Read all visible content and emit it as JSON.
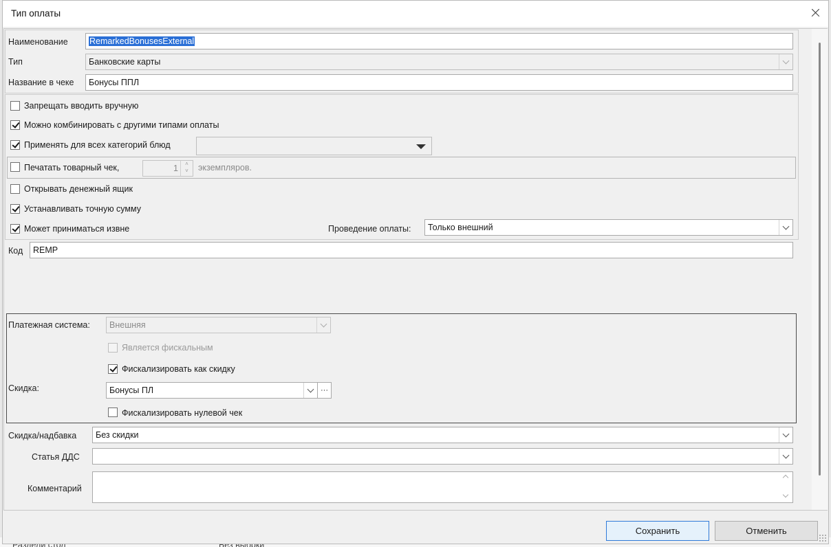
{
  "dialog": {
    "title": "Тип оплаты"
  },
  "fields": {
    "name_label": "Наименование",
    "name_value": "RemarkedBonusesExternal",
    "type_label": "Тип",
    "type_value": "Банковские карты",
    "receipt_name_label": "Название в чеке",
    "receipt_name_value": "Бонусы ППЛ",
    "code_label": "Код",
    "code_value": "REMP"
  },
  "options": {
    "forbid_manual": {
      "label": "Запрещать вводить вручную",
      "checked": false
    },
    "combine": {
      "label": "Можно комбинировать с другими типами оплаты",
      "checked": true
    },
    "all_categories": {
      "label": "Применять для всех категорий блюд",
      "checked": true,
      "dropdown_value": ""
    },
    "print_receipt": {
      "label": "Печатать товарный чек,",
      "checked": false,
      "copies": "1",
      "copies_suffix": "экземпляров."
    },
    "open_drawer": {
      "label": "Открывать денежный ящик",
      "checked": false
    },
    "exact_sum": {
      "label": "Устанавливать точную сумму",
      "checked": true
    },
    "external": {
      "label": "Может приниматься извне",
      "checked": true
    },
    "processing_label": "Проведение оплаты:",
    "processing_value": "Только внешний"
  },
  "payment_system": {
    "label": "Платежная система:",
    "value": "Внешняя",
    "is_fiscal": {
      "label": "Является фискальным",
      "checked": false,
      "disabled": true
    },
    "fiscalize_discount": {
      "label": "Фискализировать как скидку",
      "checked": true
    },
    "discount_label": "Скидка:",
    "discount_value": "Бонусы ПЛ",
    "ellipsis": "···",
    "fiscalize_zero": {
      "label": "Фискализировать нулевой чек",
      "checked": false
    }
  },
  "bottom": {
    "surcharge_label": "Скидка/надбавка",
    "surcharge_value": "Без скидки",
    "dds_label": "Статья ДДС",
    "dds_value": "",
    "comment_label": "Комментарий",
    "comment_value": ""
  },
  "buttons": {
    "save": "Сохранить",
    "cancel": "Отменить"
  },
  "background": {
    "cell1": "Раздели стол",
    "cell2": "Без выбрки"
  },
  "colors": {
    "selection": "#2a6fd6",
    "primary_border": "#2f7ad8"
  }
}
